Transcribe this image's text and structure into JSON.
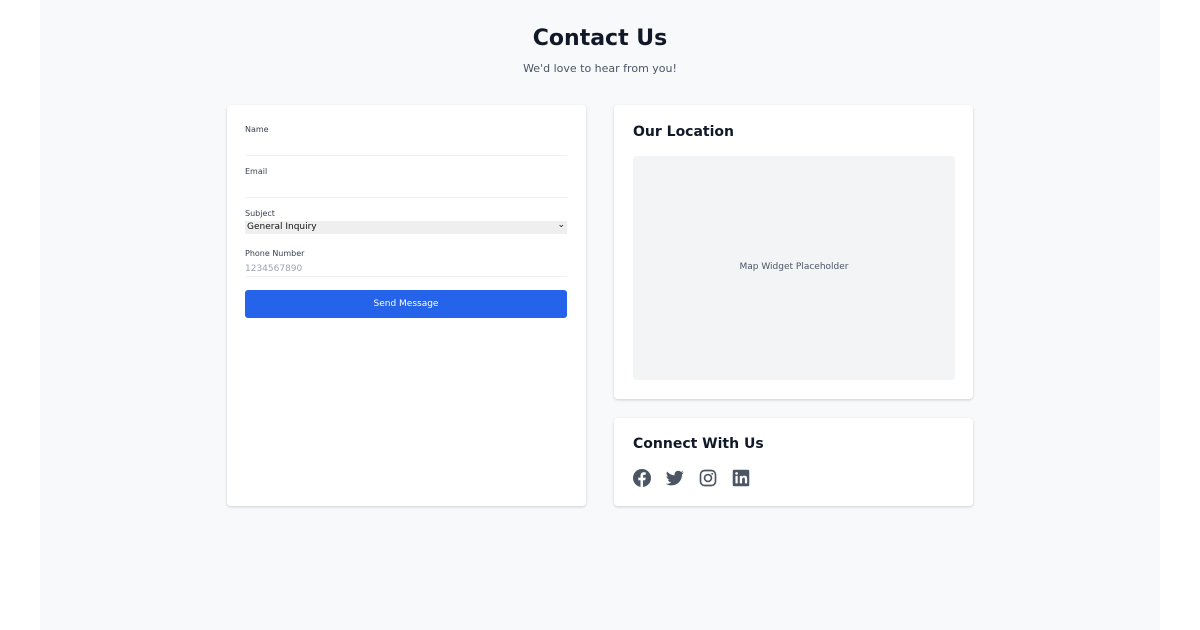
{
  "header": {
    "title": "Contact Us",
    "subtitle": "We'd love to hear from you!"
  },
  "form": {
    "name_label": "Name",
    "name_value": "",
    "email_label": "Email",
    "email_value": "",
    "subject_label": "Subject",
    "subject_value": "General Inquiry",
    "phone_label": "Phone Number",
    "phone_placeholder": "1234567890",
    "submit_label": "Send Message"
  },
  "location": {
    "heading": "Our Location",
    "map_placeholder": "Map Widget Placeholder"
  },
  "social": {
    "heading": "Connect With Us",
    "icons": [
      "facebook-icon",
      "twitter-icon",
      "instagram-icon",
      "linkedin-icon"
    ]
  },
  "colors": {
    "accent": "#2563eb",
    "icon": "#4b5563",
    "page_background": "#f8f9fb"
  }
}
